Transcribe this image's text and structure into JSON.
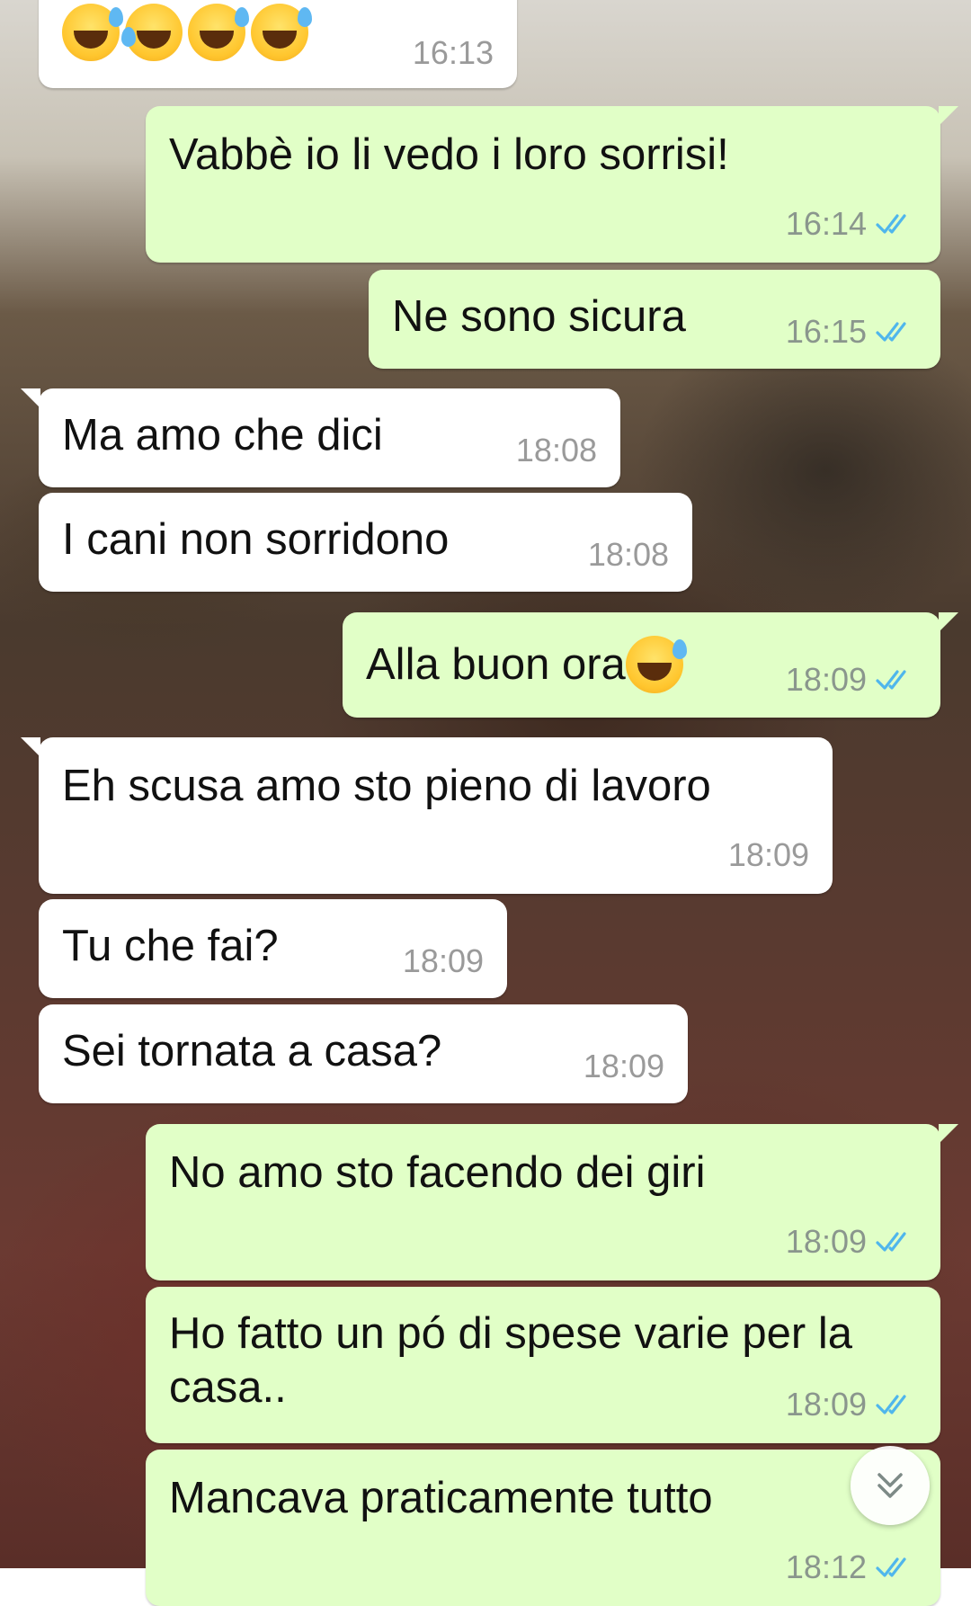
{
  "chat": {
    "messages": [
      {
        "id": "m1",
        "direction": "incoming",
        "emojis": [
          "grinning-sweat",
          "tears-of-joy",
          "grinning-sweat",
          "grinning-sweat"
        ],
        "time": "16:13"
      },
      {
        "id": "m2",
        "direction": "outgoing",
        "text": "Vabbè io li vedo i loro sorrisi!",
        "time": "16:14",
        "status": "read"
      },
      {
        "id": "m3",
        "direction": "outgoing",
        "text": "Ne sono sicura",
        "time": "16:15",
        "status": "read"
      },
      {
        "id": "m4",
        "direction": "incoming",
        "text": "Ma amo che dici",
        "time": "18:08"
      },
      {
        "id": "m5",
        "direction": "incoming",
        "text": "I cani non sorridono",
        "time": "18:08"
      },
      {
        "id": "m6",
        "direction": "outgoing",
        "text": "Alla buon ora",
        "emoji": "grinning-sweat",
        "time": "18:09",
        "status": "read"
      },
      {
        "id": "m7",
        "direction": "incoming",
        "text": "Eh scusa amo sto pieno di lavoro",
        "time": "18:09"
      },
      {
        "id": "m8",
        "direction": "incoming",
        "text": "Tu che fai?",
        "time": "18:09"
      },
      {
        "id": "m9",
        "direction": "incoming",
        "text": "Sei tornata a casa?",
        "time": "18:09"
      },
      {
        "id": "m10",
        "direction": "outgoing",
        "text": "No amo sto facendo dei giri",
        "time": "18:09",
        "status": "read"
      },
      {
        "id": "m11",
        "direction": "outgoing",
        "text": "Ho fatto un pó di spese varie per la casa..",
        "time": "18:09",
        "status": "read"
      },
      {
        "id": "m12",
        "direction": "outgoing",
        "text": "Mancava praticamente tutto",
        "time": "18:12",
        "status": "read"
      }
    ]
  },
  "colors": {
    "incoming_bubble": "#ffffff",
    "outgoing_bubble": "#e1ffc7",
    "read_tick": "#4fb6ec"
  },
  "icons": {
    "read_status": "double-check-icon",
    "scroll_down": "double-chevron-down-icon"
  }
}
